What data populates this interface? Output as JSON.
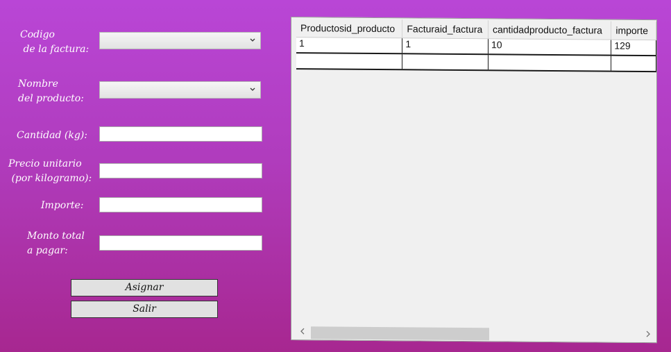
{
  "form": {
    "invoice_code_label": "Codigo\n de la factura:",
    "product_name_label": "Nombre\ndel producto:",
    "quantity_label": "Cantidad (kg):",
    "unit_price_label": "Precio unitario\n (por kilogramo):",
    "amount_label": "Importe:",
    "total_label": "Monto total\na pagar:",
    "invoice_code_value": "",
    "product_name_value": "",
    "quantity_value": "",
    "unit_price_value": "",
    "amount_value": "",
    "total_value": ""
  },
  "buttons": {
    "assign_label": "Asignar",
    "exit_label": "Salir"
  },
  "grid": {
    "columns": [
      "Productosid_producto",
      "Facturaid_factura",
      "cantidadproducto_factura",
      "importe"
    ],
    "rows": [
      [
        "1",
        "1",
        "10",
        "129"
      ],
      [
        "",
        "",
        "",
        ""
      ]
    ]
  },
  "icons": {
    "combo_arrow": "chevron-down-icon",
    "scroll_left": "chevron-left-icon",
    "scroll_right": "chevron-right-icon"
  },
  "colors": {
    "background_top": "#b946d6",
    "background_bottom": "#a72790"
  }
}
